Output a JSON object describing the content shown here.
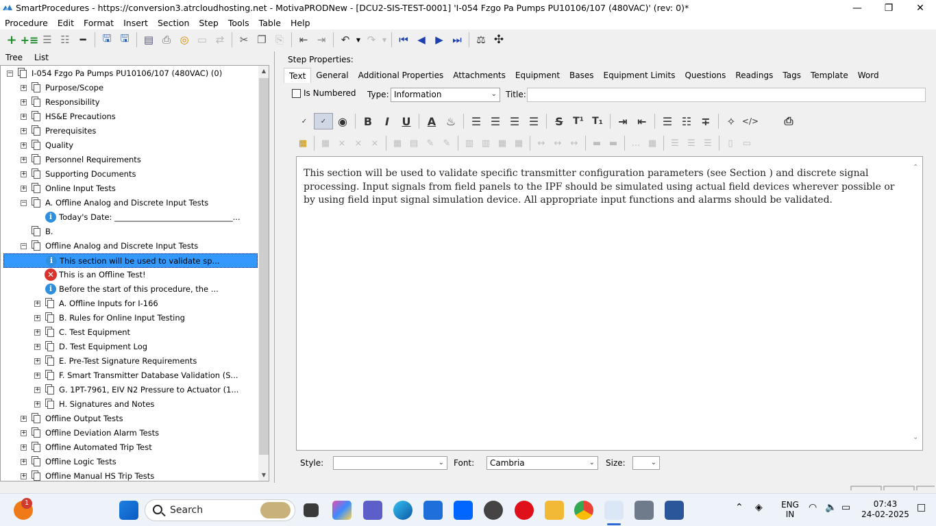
{
  "window": {
    "title": "SmartProcedures - https://conversion3.atrcloudhosting.net - MotivaPRODNew - [DCU2-SIS-TEST-0001] 'I-054 Fzgo Pa Pumps PU10106/107 (480VAC)' (rev: 0)*"
  },
  "menu": [
    "Procedure",
    "Edit",
    "Format",
    "Insert",
    "Section",
    "Step",
    "Tools",
    "Table",
    "Help"
  ],
  "left_tabs": {
    "tree": "Tree",
    "list": "List"
  },
  "tree": [
    {
      "text": "I-054 Fzgo Pa Pumps PU10106/107 (480VAC) (0)",
      "level": 0,
      "kind": "doc",
      "expander": "minus"
    },
    {
      "text": "Purpose/Scope",
      "level": 1,
      "kind": "doc",
      "expander": "plus"
    },
    {
      "text": "Responsibility",
      "level": 1,
      "kind": "doc",
      "expander": "plus"
    },
    {
      "text": "HS&E Precautions",
      "level": 1,
      "kind": "doc",
      "expander": "plus"
    },
    {
      "text": "Prerequisites",
      "level": 1,
      "kind": "doc",
      "expander": "plus"
    },
    {
      "text": "Quality",
      "level": 1,
      "kind": "doc",
      "expander": "plus"
    },
    {
      "text": "Personnel Requirements",
      "level": 1,
      "kind": "doc",
      "expander": "plus"
    },
    {
      "text": "Supporting Documents",
      "level": 1,
      "kind": "doc",
      "expander": "plus"
    },
    {
      "text": "Online Input Tests",
      "level": 1,
      "kind": "doc",
      "expander": "plus"
    },
    {
      "text": "A. Offline Analog and Discrete Input Tests",
      "level": 1,
      "kind": "doc",
      "expander": "minus"
    },
    {
      "text": "Today's Date: ______________________________...",
      "level": 2,
      "kind": "info",
      "expander": ""
    },
    {
      "text": "B.",
      "level": 1,
      "kind": "doc",
      "expander": ""
    },
    {
      "text": "Offline Analog and Discrete Input Tests",
      "level": 1,
      "kind": "doc",
      "expander": "minus"
    },
    {
      "text": "This section will be used to validate sp...",
      "level": 2,
      "kind": "info",
      "expander": "",
      "selected": true
    },
    {
      "text": "This is an Offline Test!",
      "level": 2,
      "kind": "error",
      "expander": ""
    },
    {
      "text": "Before the start of this procedure, the ...",
      "level": 2,
      "kind": "info",
      "expander": ""
    },
    {
      "text": "A. Offline Inputs for I-166",
      "level": 2,
      "kind": "doc",
      "expander": "plus"
    },
    {
      "text": "B. Rules for Online Input Testing",
      "level": 2,
      "kind": "doc",
      "expander": "plus"
    },
    {
      "text": "C. Test Equipment",
      "level": 2,
      "kind": "doc",
      "expander": "plus"
    },
    {
      "text": "D. Test Equipment Log",
      "level": 2,
      "kind": "doc",
      "expander": "plus"
    },
    {
      "text": "E. Pre-Test Signature Requirements",
      "level": 2,
      "kind": "doc",
      "expander": "plus"
    },
    {
      "text": "F. Smart Transmitter Database Validation (S...",
      "level": 2,
      "kind": "doc",
      "expander": "plus"
    },
    {
      "text": "G. 1PT-7961, EIV N2 Pressure to Actuator (1...",
      "level": 2,
      "kind": "doc",
      "expander": "plus"
    },
    {
      "text": "H. Signatures and Notes",
      "level": 2,
      "kind": "doc",
      "expander": "plus"
    },
    {
      "text": "Offline Output Tests",
      "level": 1,
      "kind": "doc",
      "expander": "plus"
    },
    {
      "text": "Offline Deviation Alarm Tests",
      "level": 1,
      "kind": "doc",
      "expander": "plus"
    },
    {
      "text": "Offline Automated Trip Test",
      "level": 1,
      "kind": "doc",
      "expander": "plus"
    },
    {
      "text": "Offline Logic Tests",
      "level": 1,
      "kind": "doc",
      "expander": "plus"
    },
    {
      "text": "Offline Manual HS Trip Tests",
      "level": 1,
      "kind": "doc",
      "expander": "plus"
    }
  ],
  "step_props": {
    "heading": "Step Properties:",
    "tabs": [
      "Text",
      "General",
      "Additional Properties",
      "Attachments",
      "Equipment",
      "Bases",
      "Equipment Limits",
      "Questions",
      "Readings",
      "Tags",
      "Template",
      "Word"
    ],
    "active_tab": "Text",
    "is_numbered_label": "Is Numbered",
    "type_label": "Type:",
    "type_value": "Information",
    "title_label": "Title:",
    "title_value": "",
    "editor_text": "This section will be used to validate specific transmitter configuration parameters (see Section ) and discrete signal processing. Input signals from field panels to the IPF should be simulated using actual field devices wherever possible or by using field input signal simulation device. All appropriate input functions and alarms should be validated.",
    "style_label": "Style:",
    "style_value": "",
    "font_label": "Font:",
    "font_value": "Cambria",
    "size_label": "Size:",
    "size_value": ""
  },
  "format_buttons": [
    "B",
    "I",
    "U"
  ],
  "format_glyphs": {
    "code": "</>",
    "strike": "S",
    "superscript": "T¹",
    "subscript": "T₁"
  },
  "taskbar": {
    "search_label": "Search",
    "notif_count": "1",
    "lang_top": "ENG",
    "lang_bottom": "IN",
    "time": "07:43",
    "date": "24-02-2025"
  },
  "colors": {
    "selection": "#3399ff",
    "info": "#2f8fdd",
    "error": "#d9342b"
  }
}
